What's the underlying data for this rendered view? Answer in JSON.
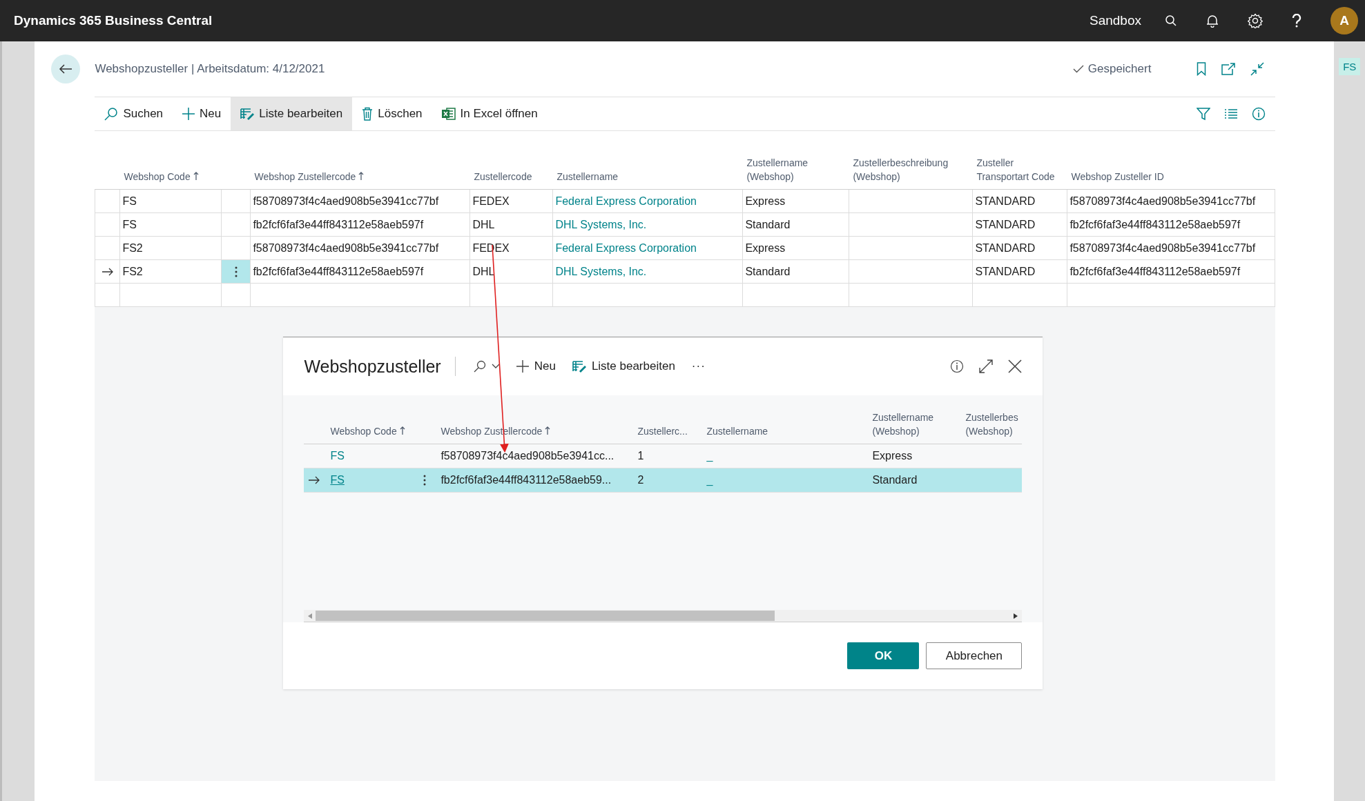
{
  "app": {
    "title": "Dynamics 365 Business Central",
    "environment": "Sandbox",
    "avatar": "A"
  },
  "page": {
    "breadcrumb": "Webshopzusteller | Arbeitsdatum: 4/12/2021",
    "status": "Gespeichert",
    "side_badge": "FS"
  },
  "actions": [
    {
      "kind": "search",
      "label": "Suchen",
      "selected": false
    },
    {
      "kind": "new",
      "label": "Neu",
      "selected": false
    },
    {
      "kind": "edit-list",
      "label": "Liste bearbeiten",
      "selected": true
    },
    {
      "kind": "delete",
      "label": "Löschen",
      "selected": false
    },
    {
      "kind": "excel",
      "label": "In Excel öffnen",
      "selected": false
    }
  ],
  "table": {
    "columns": [
      {
        "label": "Webshop Code",
        "sorted": true,
        "kind": "text"
      },
      {
        "label": "Webshop Zustellercode",
        "sorted": true,
        "kind": "text"
      },
      {
        "label": "Zustellercode",
        "sorted": false,
        "kind": "text"
      },
      {
        "label": "Zustellername",
        "sorted": false,
        "kind": "link"
      },
      {
        "label": "Zustellername (Webshop)",
        "sorted": false,
        "kind": "text"
      },
      {
        "label": "Zustellerbeschreibung (Webshop)",
        "sorted": false,
        "kind": "text"
      },
      {
        "label": "Zusteller Transportart Code",
        "sorted": false,
        "kind": "text"
      },
      {
        "label": "Webshop Zusteller ID",
        "sorted": false,
        "kind": "text"
      }
    ],
    "rows": [
      {
        "selected": false,
        "cells": [
          "FS",
          "f58708973f4c4aed908b5e3941cc77bf",
          "FEDEX",
          "Federal Express Corporation",
          "Express",
          "",
          "STANDARD",
          "f58708973f4c4aed908b5e3941cc77bf"
        ]
      },
      {
        "selected": false,
        "cells": [
          "FS",
          "fb2fcf6faf3e44ff843112e58aeb597f",
          "DHL",
          "DHL Systems, Inc.",
          "Standard",
          "",
          "STANDARD",
          "fb2fcf6faf3e44ff843112e58aeb597f"
        ]
      },
      {
        "selected": false,
        "cells": [
          "FS2",
          "f58708973f4c4aed908b5e3941cc77bf",
          "FEDEX",
          "Federal Express Corporation",
          "Express",
          "",
          "STANDARD",
          "f58708973f4c4aed908b5e3941cc77bf"
        ]
      },
      {
        "selected": true,
        "cells": [
          "FS2",
          "fb2fcf6faf3e44ff843112e58aeb597f",
          "DHL",
          "DHL Systems, Inc.",
          "Standard",
          "",
          "STANDARD",
          "fb2fcf6faf3e44ff843112e58aeb597f"
        ]
      }
    ]
  },
  "dialog": {
    "title": "Webshopzusteller",
    "actions": [
      {
        "kind": "search"
      },
      {
        "kind": "new",
        "label": "Neu"
      },
      {
        "kind": "edit-list",
        "label": "Liste bearbeiten"
      },
      {
        "kind": "more",
        "label": "···"
      }
    ],
    "columns": [
      {
        "label": "Webshop Code",
        "sorted": true,
        "kind": "link"
      },
      {
        "label": "Webshop Zustellercode",
        "sorted": true,
        "kind": "text"
      },
      {
        "label": "Zustellerc...",
        "sorted": false,
        "kind": "text"
      },
      {
        "label": "Zustellername",
        "sorted": false,
        "kind": "link"
      },
      {
        "label": "Zustellername (Webshop)",
        "sorted": false,
        "kind": "text"
      },
      {
        "label": "Zustellerbes (Webshop)",
        "sorted": false,
        "kind": "text"
      }
    ],
    "rows": [
      {
        "selected": false,
        "cells": [
          "FS",
          "f58708973f4c4aed908b5e3941cc...",
          "1",
          "_",
          "Express",
          ""
        ]
      },
      {
        "selected": true,
        "cells": [
          "FS",
          "fb2fcf6faf3e44ff843112e58aeb59...",
          "2",
          "_",
          "Standard",
          ""
        ]
      }
    ],
    "buttons": [
      {
        "label": "OK",
        "kind": "primary"
      },
      {
        "label": "Abbrechen",
        "kind": "secondary"
      }
    ]
  }
}
